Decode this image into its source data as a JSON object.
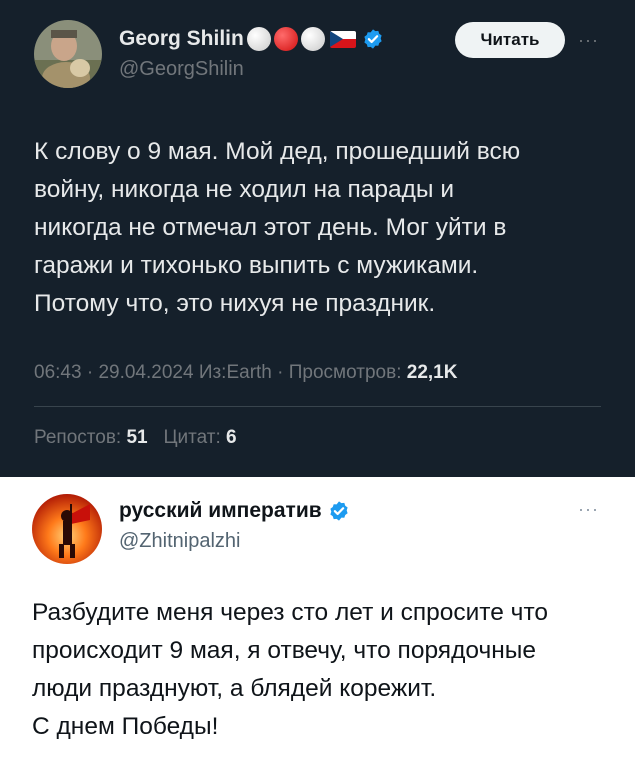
{
  "tweet1": {
    "display_name": "Georg Shilin",
    "handle": "@GeorgShilin",
    "follow_label": "Читать",
    "more_label": "···",
    "text": "К слову о 9 мая. Мой дед, прошедший всю\nвойну, никогда не ходил на парады и\nникогда не отмечал этот день. Мог уйти в\nгаражи и тихонько выпить с мужиками.\nПотому что, это нихуя не праздник.",
    "time": "06:43",
    "date": "29.04.2024",
    "source": "Из:Earth",
    "views_label": "Просмотров:",
    "views_value": "22,1K",
    "reposts_label": "Репостов:",
    "reposts_value": "51",
    "quotes_label": "Цитат:",
    "quotes_value": "6",
    "separator": "·"
  },
  "tweet2": {
    "display_name": "русский императив",
    "handle": "@Zhitnipalzhi",
    "more_label": "···",
    "text": "Разбудите меня через сто лет и спросите что\nпроисходит 9 мая, я отвечу, что порядочные\nлюди празднуют, а блядей корежит.\nС днем Победы!"
  },
  "colors": {
    "dark_bg": "#15202b",
    "verified_blue": "#1d9bf0",
    "muted": "#71767b"
  },
  "icons": {
    "verified": "verified-badge-icon",
    "more": "more-options-icon"
  }
}
